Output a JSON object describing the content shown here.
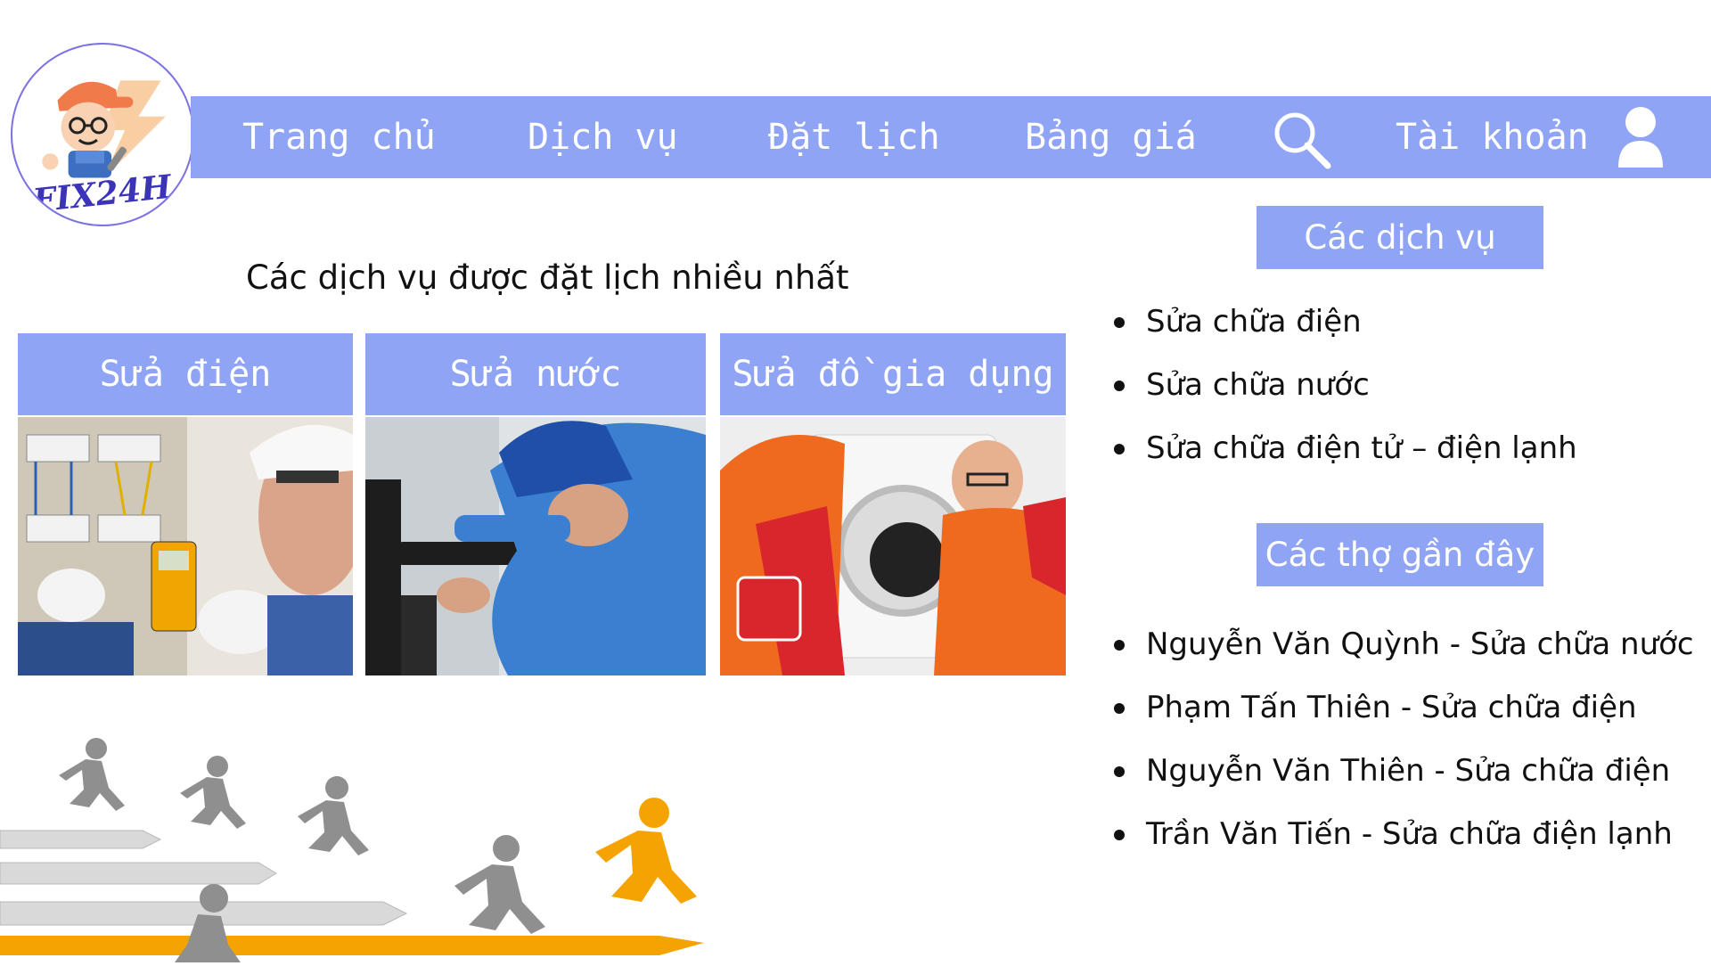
{
  "logo": {
    "text": "FIX24H"
  },
  "nav": {
    "items": [
      "Trang chủ",
      "Dịch vụ",
      "Đặt lịch",
      "Bảng giá"
    ],
    "account_label": "Tài khoản",
    "search_icon": "search-icon",
    "user_icon": "user-icon"
  },
  "popular": {
    "title": "Các dịch vụ được đặt lịch nhiều nhất",
    "cards": [
      {
        "label": "Sửa điện"
      },
      {
        "label": "Sửa nước"
      },
      {
        "label": "Sửa đồ gia dụng"
      }
    ]
  },
  "services": {
    "heading": "Các dịch vụ",
    "items": [
      "Sửa chữa điện",
      "Sửa chữa nước",
      "Sửa chữa điện tử – điện lạnh"
    ]
  },
  "recent_workers": {
    "heading": "Các thợ gần đây",
    "items": [
      "Nguyễn Văn Quỳnh - Sửa chữa nước",
      "Phạm Tấn Thiên - Sửa chữa điện",
      "Nguyễn Văn Thiên - Sửa chữa điện",
      "Trần Văn Tiến - Sửa chữa điện lạnh"
    ]
  },
  "colors": {
    "accent": "#8fa4f4",
    "text": "#111111",
    "orange": "#f5a300"
  }
}
